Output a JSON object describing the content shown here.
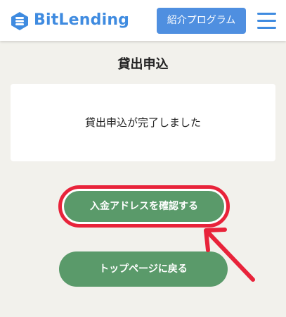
{
  "header": {
    "brand": "BitLending",
    "referral_button": "紹介プログラム",
    "menu_icon": "hamburger-menu-icon",
    "logo_icon": "bitlending-logo-icon",
    "brand_color": "#3f8be0"
  },
  "main": {
    "title": "貸出申込",
    "message": "貸出申込が完了しました",
    "confirm_button": "入金アドレスを確認する",
    "top_button": "トップページに戻る"
  },
  "annotation": {
    "highlight_color": "#e8233a",
    "arrow_icon": "pointer-arrow-icon"
  },
  "colors": {
    "background": "#f2f1ec",
    "button_green": "#5a9a6a",
    "referral_blue": "#4f8fe0"
  }
}
